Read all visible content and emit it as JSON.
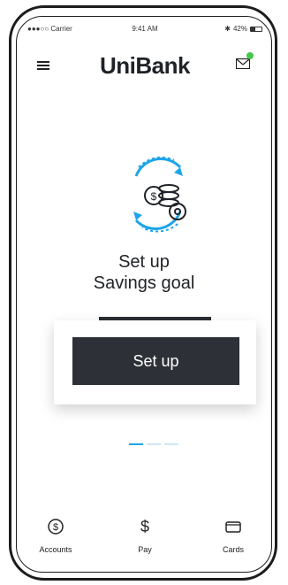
{
  "status_bar": {
    "carrier": "●●●○○ Carrier",
    "time": "9:41 AM",
    "battery_text": "42%",
    "battery_level": 0.42
  },
  "header": {
    "brand": "UniBank",
    "notification_color": "#46c74a"
  },
  "hero": {
    "title_line1": "Set up",
    "title_line2": "Savings goal",
    "icon": "savings-goal-icon",
    "accent_color": "#1ea5e9"
  },
  "cta": {
    "button_label": "Set up"
  },
  "pager": {
    "pages": 3,
    "active_index": 0
  },
  "bottom_nav": {
    "items": [
      {
        "label": "Accounts",
        "icon": "dollar-circle-icon"
      },
      {
        "label": "Pay",
        "icon": "dollar-sign-icon"
      },
      {
        "label": "Cards",
        "icon": "card-icon"
      }
    ]
  }
}
